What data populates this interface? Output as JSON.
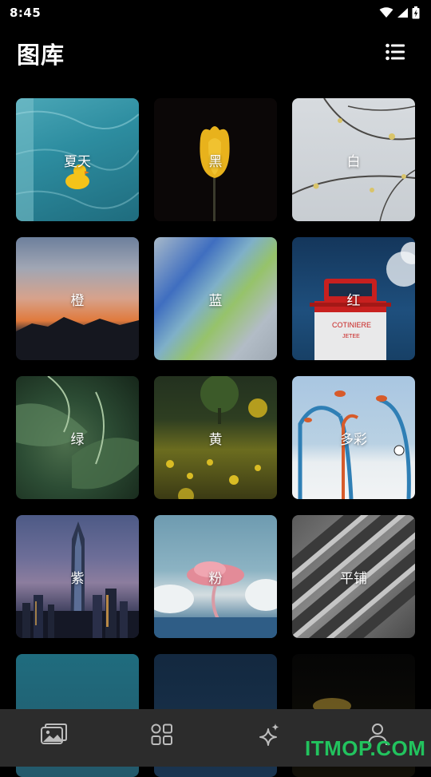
{
  "status_bar": {
    "time": "8:45"
  },
  "header": {
    "title": "图库",
    "list_icon": "list-view-icon"
  },
  "categories": [
    {
      "label": "夏天"
    },
    {
      "label": "黑"
    },
    {
      "label": "白"
    },
    {
      "label": "橙"
    },
    {
      "label": "蓝"
    },
    {
      "label": "红"
    },
    {
      "label": "绿"
    },
    {
      "label": "黄"
    },
    {
      "label": "多彩"
    },
    {
      "label": "紫"
    },
    {
      "label": "粉"
    },
    {
      "label": "平铺"
    },
    {
      "label": ""
    },
    {
      "label": ""
    },
    {
      "label": ""
    }
  ],
  "bottom_nav": [
    {
      "icon": "gallery-icon"
    },
    {
      "icon": "categories-icon"
    },
    {
      "icon": "sparkle-icon"
    },
    {
      "icon": "profile-icon"
    }
  ],
  "watermark": {
    "text": "ITMOP.COM"
  },
  "colors": {
    "background": "#000000",
    "nav_bar": "#2c2c2c",
    "watermark": "#22c35e"
  }
}
